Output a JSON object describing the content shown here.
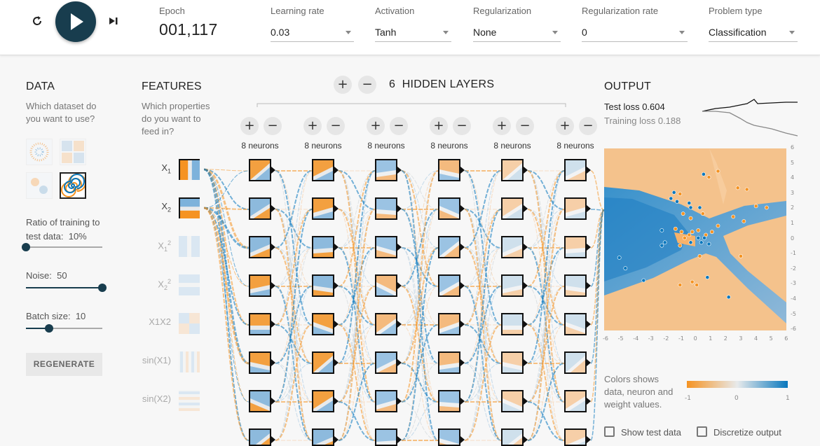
{
  "header": {
    "epoch_label": "Epoch",
    "epoch_value": "001,117",
    "learning_rate_label": "Learning rate",
    "learning_rate_value": "0.03",
    "activation_label": "Activation",
    "activation_value": "Tanh",
    "regularization_label": "Regularization",
    "regularization_value": "None",
    "regularization_rate_label": "Regularization rate",
    "regularization_rate_value": "0",
    "problem_type_label": "Problem type",
    "problem_type_value": "Classification",
    "reset_icon": "reset-icon",
    "play_icon": "play-icon",
    "step_icon": "step-forward-icon"
  },
  "data_panel": {
    "title": "DATA",
    "subtitle": "Which dataset do you want to use?",
    "datasets": [
      "circle",
      "xor",
      "gaussian",
      "spiral"
    ],
    "selected_dataset": "spiral",
    "ratio_label": "Ratio of training to test data:",
    "ratio_value": "10%",
    "ratio_fraction": 0.0,
    "noise_label": "Noise:",
    "noise_value": "50",
    "noise_fraction": 1.0,
    "batch_label": "Batch size:",
    "batch_value": "10",
    "batch_fraction": 0.3,
    "regenerate_label": "REGENERATE"
  },
  "features": {
    "title": "FEATURES",
    "subtitle": "Which properties do you want to feed in?",
    "items": [
      {
        "label": "X",
        "sub": "1",
        "sup": "",
        "active": true
      },
      {
        "label": "X",
        "sub": "2",
        "sup": "",
        "active": true
      },
      {
        "label": "X",
        "sub": "1",
        "sup": "2",
        "active": false
      },
      {
        "label": "X",
        "sub": "2",
        "sup": "2",
        "active": false
      },
      {
        "label": "X1X2",
        "sub": "",
        "sup": "",
        "active": false
      },
      {
        "label": "sin(X1)",
        "sub": "",
        "sup": "",
        "active": false
      },
      {
        "label": "sin(X2)",
        "sub": "",
        "sup": "",
        "active": false
      }
    ]
  },
  "network": {
    "layer_count": "6",
    "layers_label": "HIDDEN LAYERS",
    "add_layer_symbol": "+",
    "remove_layer_symbol": "−",
    "layers": [
      {
        "neurons": "8 neurons"
      },
      {
        "neurons": "8 neurons"
      },
      {
        "neurons": "8 neurons"
      },
      {
        "neurons": "8 neurons"
      },
      {
        "neurons": "8 neurons"
      },
      {
        "neurons": "8 neurons"
      }
    ]
  },
  "output": {
    "title": "OUTPUT",
    "test_loss_label": "Test loss",
    "test_loss_value": "0.604",
    "training_loss_label": "Training loss",
    "training_loss_value": "0.188",
    "x_ticks": [
      "-6",
      "-5",
      "-4",
      "-3",
      "-2",
      "-1",
      "0",
      "1",
      "2",
      "3",
      "4",
      "5",
      "6"
    ],
    "y_ticks": [
      "6",
      "5",
      "4",
      "3",
      "2",
      "1",
      "0",
      "-1",
      "-2",
      "-3",
      "-4",
      "-5",
      "-6"
    ],
    "legend_text": "Colors shows data, neuron and weight values.",
    "legend_min": "-1",
    "legend_mid": "0",
    "legend_max": "1",
    "show_test_label": "Show test data",
    "discretize_label": "Discretize output",
    "colors": {
      "negative": "#f59322",
      "positive": "#0877bd",
      "neutral": "#e8eaeb"
    }
  }
}
